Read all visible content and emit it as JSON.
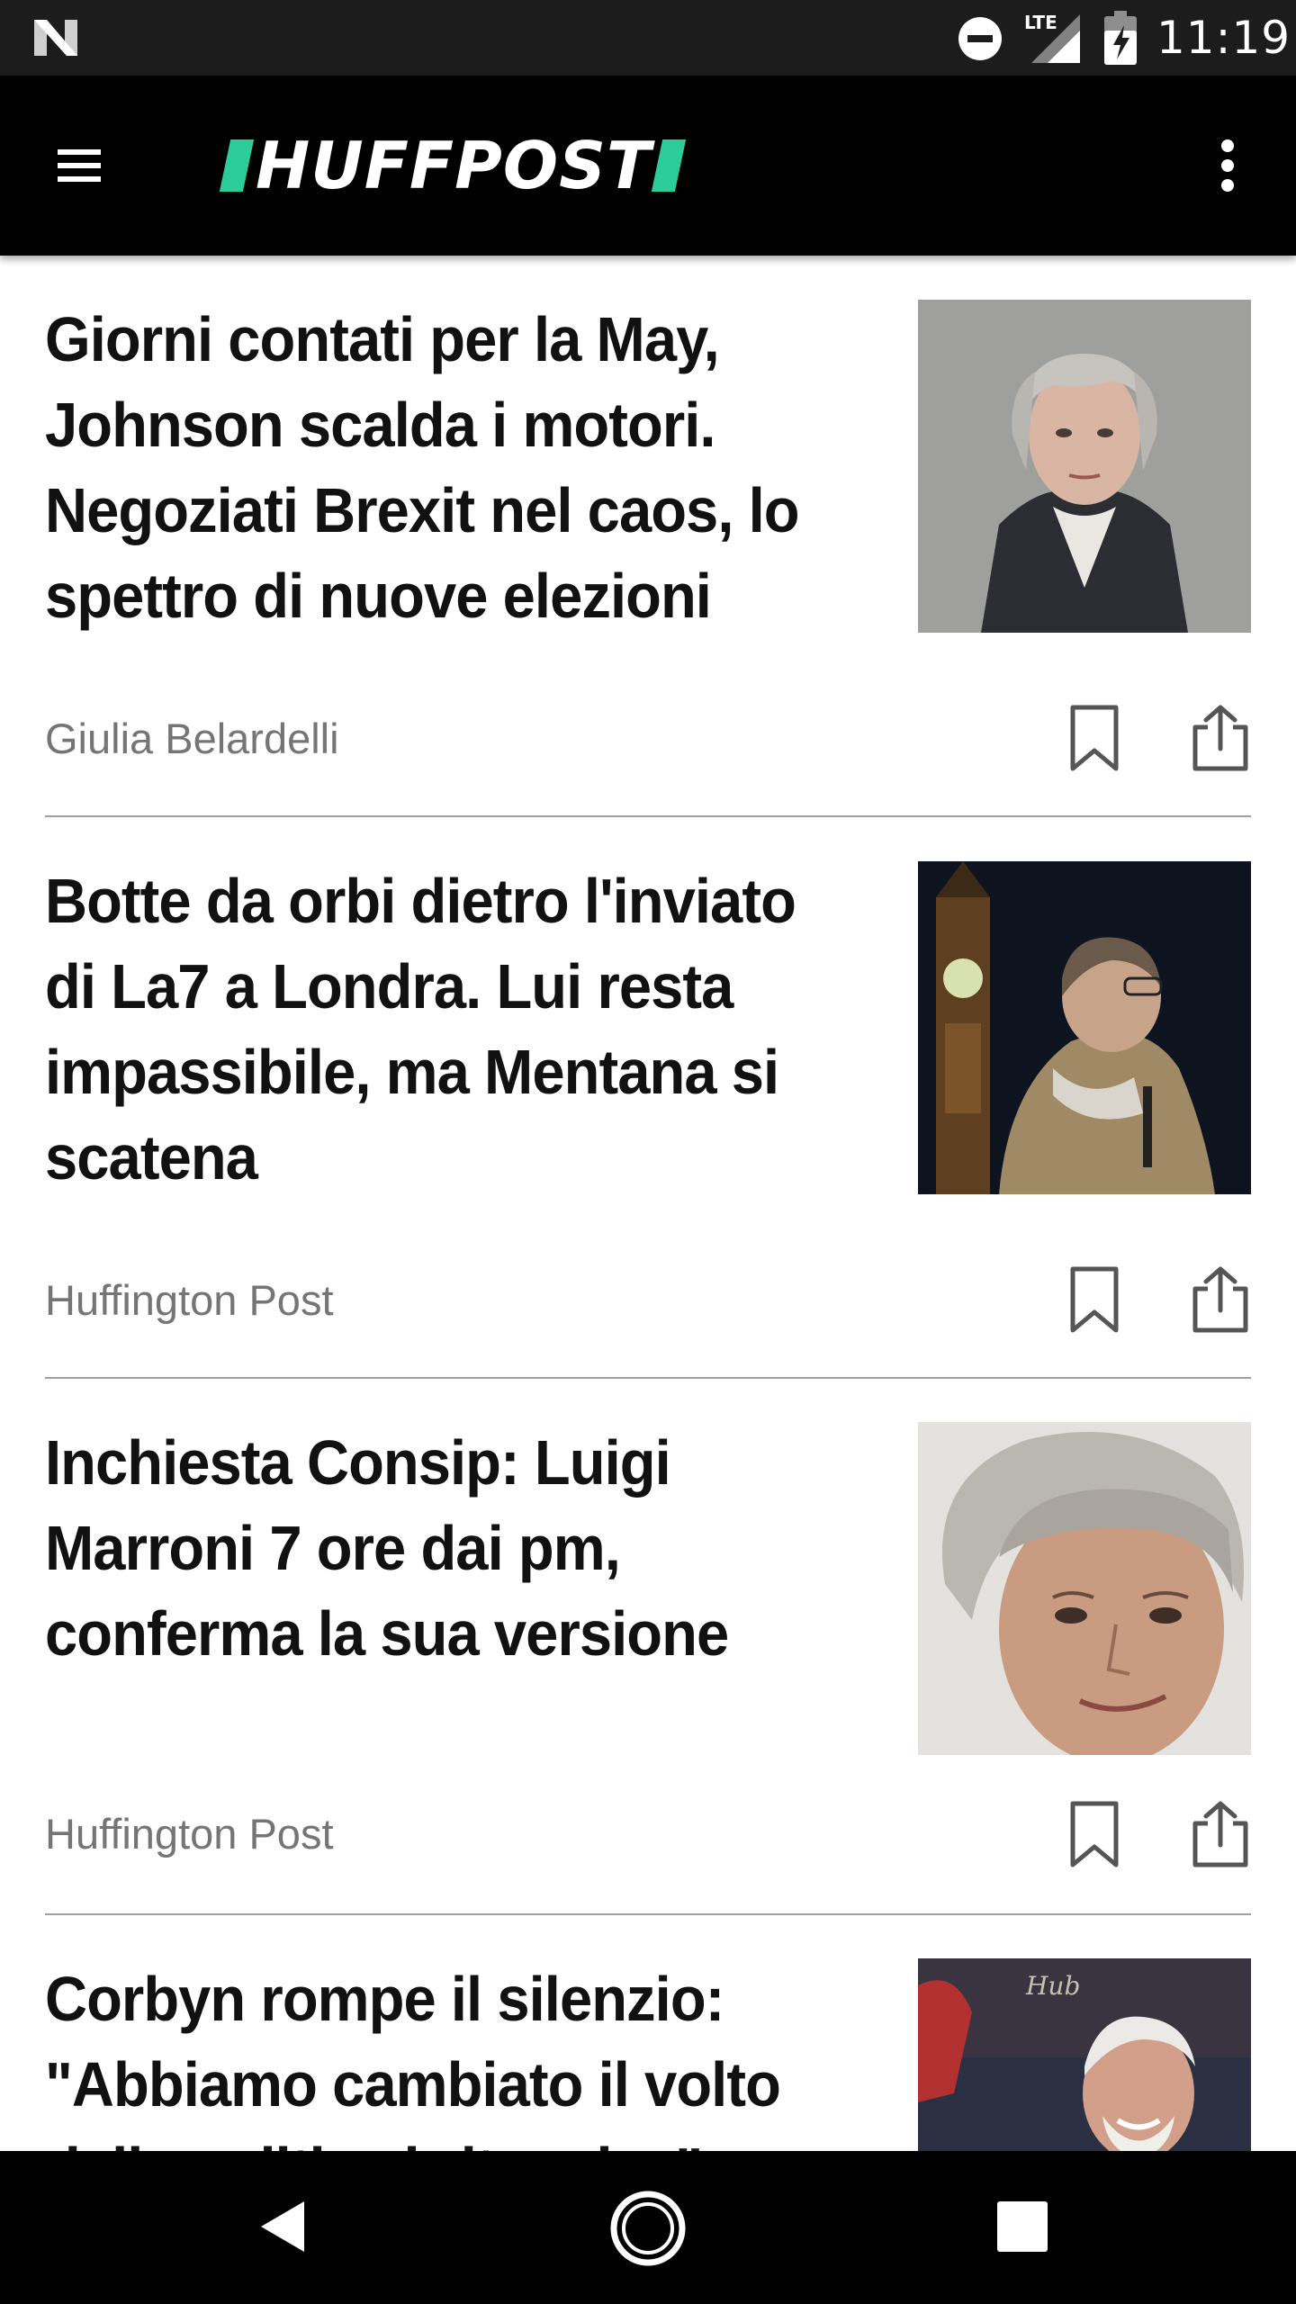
{
  "status_bar": {
    "time": "11:19",
    "network": "LTE",
    "icons": [
      "notification-n-icon",
      "do-not-disturb-icon",
      "lte-signal-icon",
      "battery-charging-icon"
    ]
  },
  "app_bar": {
    "logo_text": "HUFFPOST",
    "brand_color": "#2ccd9a",
    "icons": [
      "hamburger-menu-icon",
      "more-vert-icon"
    ]
  },
  "articles": [
    {
      "headline_lines": [
        "Giorni contati per la May,",
        "Johnson scalda i motori.",
        "Negoziati Brexit nel caos, lo",
        "spettro di nuove elezioni"
      ],
      "author": "Giulia Belardelli",
      "image_subject": "woman-portrait"
    },
    {
      "headline_lines": [
        "Botte da orbi dietro l'inviato",
        "di La7 a Londra. Lui resta",
        "impassibile, ma Mentana si",
        "scatena"
      ],
      "author": "Huffington Post",
      "image_subject": "reporter-at-night-big-ben"
    },
    {
      "headline_lines": [
        "Inchiesta Consip: Luigi",
        "Marroni 7 ore dai pm,",
        "conferma la sua versione"
      ],
      "author": "Huffington Post",
      "image_subject": "man-portrait"
    },
    {
      "headline_lines": [
        "Corbyn rompe il silenzio:",
        "\"Abbiamo cambiato il volto",
        "della politica britannica\""
      ],
      "author": "",
      "image_subject": "man-smiling-crowd"
    }
  ],
  "nav_bar": {
    "icons": [
      "back-triangle-icon",
      "home-circle-icon",
      "recents-square-icon"
    ]
  }
}
